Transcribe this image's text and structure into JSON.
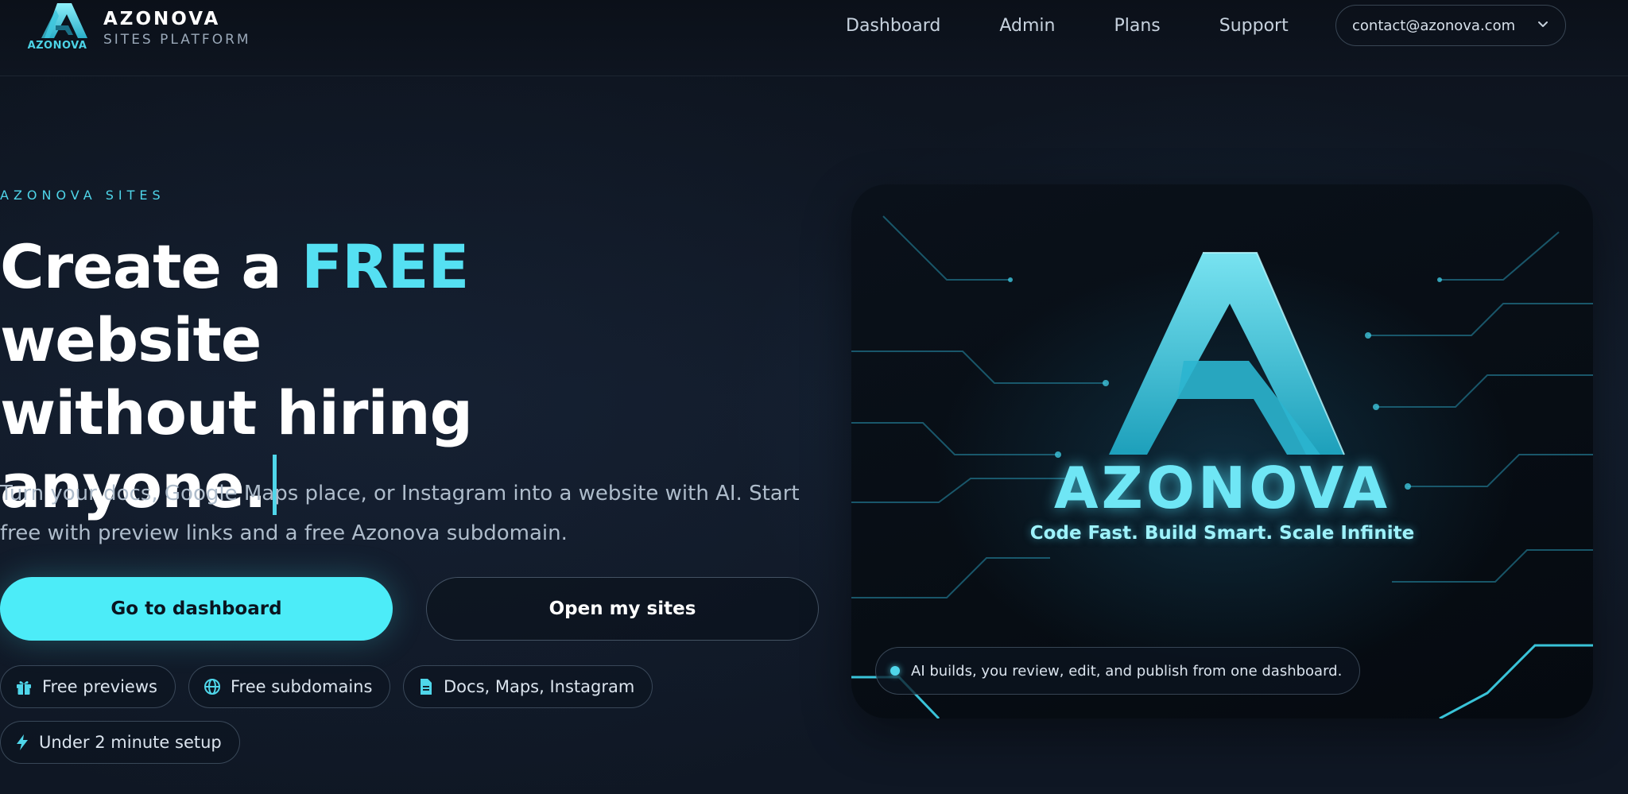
{
  "brand": {
    "logo_word": "AZONOVA",
    "name": "AZONOVA",
    "subtitle": "SITES PLATFORM"
  },
  "nav": {
    "links": [
      "Dashboard",
      "Admin",
      "Plans",
      "Support"
    ],
    "account_email": "contact@azonova.com"
  },
  "hero": {
    "eyebrow": "AZONOVA SITES",
    "headline_before": "Create a ",
    "headline_accent": "FREE",
    "headline_after_line1": " website",
    "headline_line2": "without hiring anyone.",
    "lede": "Turn your docs, Google Maps place, or Instagram into a website with AI. Start free with preview links and a free Azonova subdomain.",
    "primary_button": "Go to dashboard",
    "secondary_button": "Open my sites",
    "chips": [
      {
        "icon": "gift-icon",
        "label": "Free previews"
      },
      {
        "icon": "globe-icon",
        "label": "Free subdomains"
      },
      {
        "icon": "document-icon",
        "label": "Docs, Maps, Instagram"
      },
      {
        "icon": "lightning-icon",
        "label": "Under 2 minute setup"
      }
    ]
  },
  "showcase": {
    "wordmark": "AZONOVA",
    "tagline": "Code Fast. Build Smart. Scale Infinite",
    "caption": "AI builds, you review, edit, and publish from one dashboard."
  },
  "colors": {
    "accent": "#4cecf8",
    "background": "#0e1522",
    "text": "#ffffff"
  }
}
